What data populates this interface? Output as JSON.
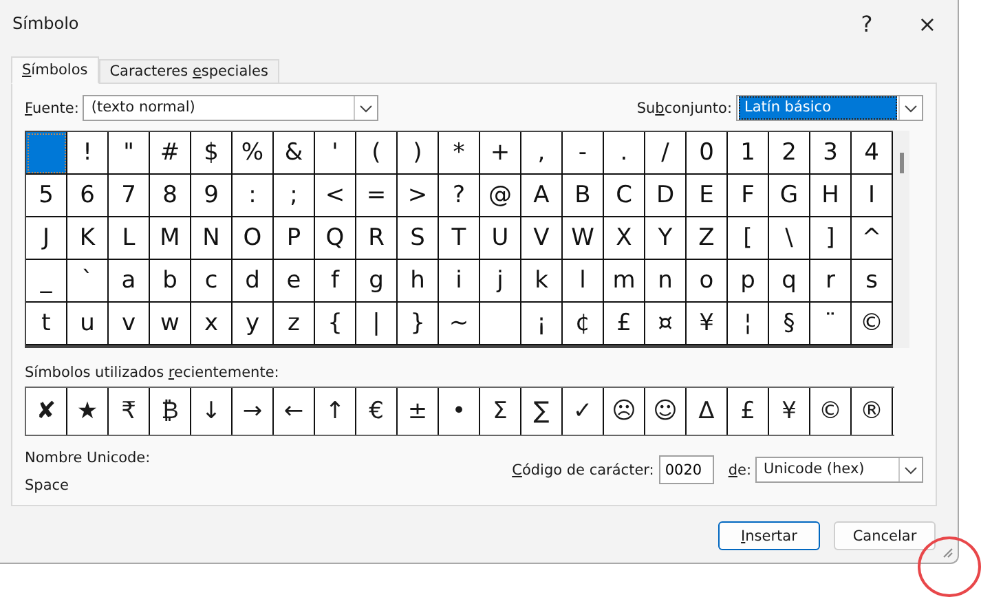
{
  "window": {
    "title": "Símbolo",
    "help": "?",
    "close": "×"
  },
  "tabs": [
    {
      "label": {
        "key": "S",
        "after": "ímbolos"
      },
      "selected": true
    },
    {
      "label": {
        "before": "Caracteres ",
        "key": "e",
        "after": "speciales"
      },
      "selected": false
    }
  ],
  "font": {
    "label": {
      "key": "F",
      "after": "uente:"
    },
    "value": "(texto normal)"
  },
  "subset": {
    "label": {
      "before": "Su",
      "key": "b",
      "after": "conjunto:"
    },
    "value": "Latín básico",
    "highlighted": true
  },
  "grid": [
    {
      "selected": true
    },
    {
      "char": "!",
      "selected": false
    },
    {
      "char": "\"",
      "selected": false
    },
    {
      "char": "#",
      "selected": false
    },
    {
      "char": "$",
      "selected": false
    },
    {
      "char": "%",
      "selected": false
    },
    {
      "char": "&",
      "selected": false
    },
    {
      "char": "'",
      "selected": false
    },
    {
      "char": "(",
      "selected": false
    },
    {
      "char": ")",
      "selected": false
    },
    {
      "char": "*",
      "selected": false
    },
    {
      "char": "+",
      "selected": false
    },
    {
      "char": ",",
      "selected": false
    },
    {
      "char": "-",
      "selected": false
    },
    {
      "char": ".",
      "selected": false
    },
    {
      "char": "/",
      "selected": false
    },
    {
      "char": "0",
      "selected": false
    },
    {
      "char": "1",
      "selected": false
    },
    {
      "char": "2",
      "selected": false
    },
    {
      "char": "3",
      "selected": false
    },
    {
      "char": "4",
      "selected": false
    },
    {
      "char": "5",
      "selected": false
    },
    {
      "char": "6",
      "selected": false
    },
    {
      "char": "7",
      "selected": false
    },
    {
      "char": "8",
      "selected": false
    },
    {
      "char": "9",
      "selected": false
    },
    {
      "char": ":",
      "selected": false
    },
    {
      "char": ";",
      "selected": false
    },
    {
      "char": "<",
      "selected": false
    },
    {
      "char": "=",
      "selected": false
    },
    {
      "char": ">",
      "selected": false
    },
    {
      "char": "?",
      "selected": false
    },
    {
      "char": "@",
      "selected": false
    },
    {
      "char": "A",
      "selected": false
    },
    {
      "char": "B",
      "selected": false
    },
    {
      "char": "C",
      "selected": false
    },
    {
      "char": "D",
      "selected": false
    },
    {
      "char": "E",
      "selected": false
    },
    {
      "char": "F",
      "selected": false
    },
    {
      "char": "G",
      "selected": false
    },
    {
      "char": "H",
      "selected": false
    },
    {
      "char": "I",
      "selected": false
    },
    {
      "char": "J",
      "selected": false
    },
    {
      "char": "K",
      "selected": false
    },
    {
      "char": "L",
      "selected": false
    },
    {
      "char": "M",
      "selected": false
    },
    {
      "char": "N",
      "selected": false
    },
    {
      "char": "O",
      "selected": false
    },
    {
      "char": "P",
      "selected": false
    },
    {
      "char": "Q",
      "selected": false
    },
    {
      "char": "R",
      "selected": false
    },
    {
      "char": "S",
      "selected": false
    },
    {
      "char": "T",
      "selected": false
    },
    {
      "char": "U",
      "selected": false
    },
    {
      "char": "V",
      "selected": false
    },
    {
      "char": "W",
      "selected": false
    },
    {
      "char": "X",
      "selected": false
    },
    {
      "char": "Y",
      "selected": false
    },
    {
      "char": "Z",
      "selected": false
    },
    {
      "char": "[",
      "selected": false
    },
    {
      "char": "\\",
      "selected": false
    },
    {
      "char": "]",
      "selected": false
    },
    {
      "char": "^",
      "selected": false
    },
    {
      "char": "_",
      "selected": false
    },
    {
      "char": "`",
      "selected": false
    },
    {
      "char": "a",
      "selected": false
    },
    {
      "char": "b",
      "selected": false
    },
    {
      "char": "c",
      "selected": false
    },
    {
      "char": "d",
      "selected": false
    },
    {
      "char": "e",
      "selected": false
    },
    {
      "char": "f",
      "selected": false
    },
    {
      "char": "g",
      "selected": false
    },
    {
      "char": "h",
      "selected": false
    },
    {
      "char": "i",
      "selected": false
    },
    {
      "char": "j",
      "selected": false
    },
    {
      "char": "k",
      "selected": false
    },
    {
      "char": "l",
      "selected": false
    },
    {
      "char": "m",
      "selected": false
    },
    {
      "char": "n",
      "selected": false
    },
    {
      "char": "o",
      "selected": false
    },
    {
      "char": "p",
      "selected": false
    },
    {
      "char": "q",
      "selected": false
    },
    {
      "char": "r",
      "selected": false
    },
    {
      "char": "s",
      "selected": false
    },
    {
      "char": "t",
      "selected": false
    },
    {
      "char": "u",
      "selected": false
    },
    {
      "char": "v",
      "selected": false
    },
    {
      "char": "w",
      "selected": false
    },
    {
      "char": "x",
      "selected": false
    },
    {
      "char": "y",
      "selected": false
    },
    {
      "char": "z",
      "selected": false
    },
    {
      "char": "{",
      "selected": false
    },
    {
      "char": "|",
      "selected": false
    },
    {
      "char": "}",
      "selected": false
    },
    {
      "char": "~",
      "selected": false
    },
    {
      "selected": false
    },
    {
      "char": "¡",
      "selected": false
    },
    {
      "char": "¢",
      "selected": false
    },
    {
      "char": "£",
      "selected": false
    },
    {
      "char": "¤",
      "selected": false
    },
    {
      "char": "¥",
      "selected": false
    },
    {
      "char": "¦",
      "selected": false
    },
    {
      "char": "§",
      "selected": false
    },
    {
      "char": "¨",
      "selected": false
    },
    {
      "char": "©",
      "selected": false
    }
  ],
  "recent": {
    "label": {
      "before": "Símbolos utilizados ",
      "key": "r",
      "after": "ecientemente:"
    },
    "symbols": [
      "✘",
      "★",
      "₹",
      "₿",
      "↓",
      "→",
      "←",
      "↑",
      "€",
      "±",
      "•",
      "Σ",
      "∑",
      "✓",
      "☹",
      "☺",
      "Δ",
      "£",
      "¥",
      "©",
      "®"
    ]
  },
  "unicode_name": {
    "label": "Nombre Unicode:",
    "value": "Space"
  },
  "char_code": {
    "label": {
      "key": "C",
      "after": "ódigo de carácter:"
    },
    "value": "0020"
  },
  "from": {
    "label": {
      "key": "d",
      "after": "e:"
    },
    "value": "Unicode (hex)"
  },
  "buttons": [
    {
      "label": {
        "key": "I",
        "after": "nsertar"
      },
      "kind": "default"
    },
    {
      "label": {
        "before": "Cancelar"
      },
      "kind": "normal"
    }
  ]
}
